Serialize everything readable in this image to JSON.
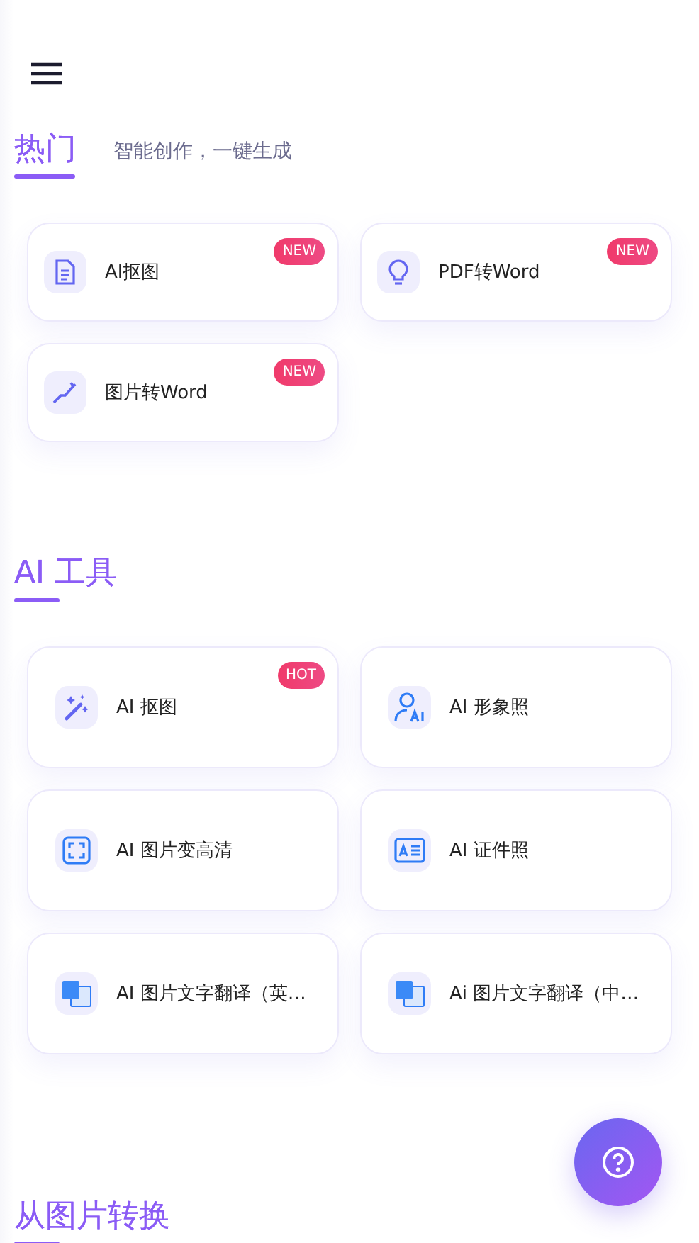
{
  "sections": [
    {
      "title": "热门",
      "subtitle": "智能创作，一键生成",
      "kind": "compact",
      "items": [
        {
          "label": "AI抠图",
          "badge": "NEW"
        },
        {
          "label": "PDF转Word",
          "badge": "NEW"
        },
        {
          "label": "图片转Word",
          "badge": "NEW"
        }
      ]
    },
    {
      "title": "AI 工具",
      "kind": "large",
      "items": [
        {
          "label": "AI 抠图",
          "badge": "HOT"
        },
        {
          "label": "AI 形象照"
        },
        {
          "label": "AI 图片变高清"
        },
        {
          "label": "AI 证件照"
        },
        {
          "label": "AI 图片文字翻译（英…"
        },
        {
          "label": "Ai 图片文字翻译（中…"
        }
      ]
    },
    {
      "title": "从图片转换",
      "kind": "large"
    }
  ]
}
